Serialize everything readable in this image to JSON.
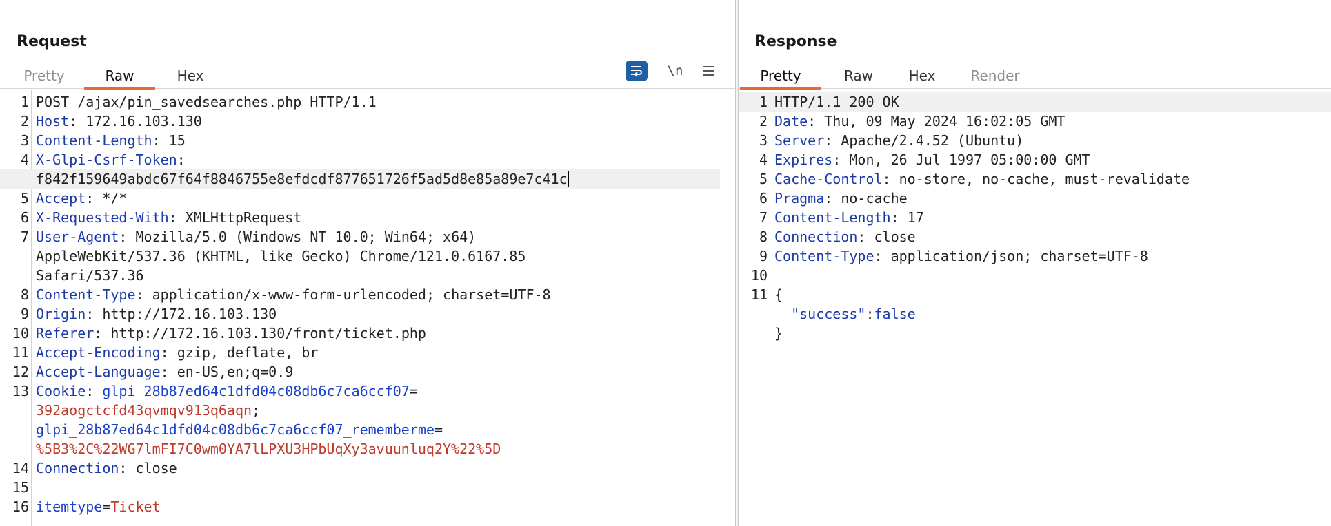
{
  "request": {
    "title": "Request",
    "tabs": [
      {
        "label": "Pretty",
        "state": "disabled"
      },
      {
        "label": "Raw",
        "state": "active"
      },
      {
        "label": "Hex",
        "state": "normal"
      }
    ],
    "toolbar": {
      "wrap_icon": "text-wrap-icon",
      "newline_label": "\\n",
      "menu_icon": "hamburger-menu-icon"
    },
    "lines": [
      {
        "n": "1",
        "plain": "POST /ajax/pin_savedsearches.php HTTP/1.1"
      },
      {
        "n": "2",
        "key": "Host",
        "value": "172.16.103.130"
      },
      {
        "n": "3",
        "key": "Content-Length",
        "value": "15"
      },
      {
        "n": "4",
        "key": "X-Glpi-Csrf-Token",
        "value": ""
      },
      {
        "n": "",
        "plain": "f842f159649abdc67f64f8846755e8efdcdf877651726f5ad5d8e85a89e7c41c",
        "current": true
      },
      {
        "n": "5",
        "key": "Accept",
        "value": "*/*"
      },
      {
        "n": "6",
        "key": "X-Requested-With",
        "value": "XMLHttpRequest"
      },
      {
        "n": "7",
        "key": "User-Agent",
        "value": "Mozilla/5.0 (Windows NT 10.0; Win64; x64)"
      },
      {
        "n": "",
        "plain": "AppleWebKit/537.36 (KHTML, like Gecko) Chrome/121.0.6167.85"
      },
      {
        "n": "",
        "plain": "Safari/537.36"
      },
      {
        "n": "8",
        "key": "Content-Type",
        "value": "application/x-www-form-urlencoded; charset=UTF-8"
      },
      {
        "n": "9",
        "key": "Origin",
        "value": "http://172.16.103.130"
      },
      {
        "n": "10",
        "key": "Referer",
        "value": "http://172.16.103.130/front/ticket.php"
      },
      {
        "n": "11",
        "key": "Accept-Encoding",
        "value": "gzip, deflate, br"
      },
      {
        "n": "12",
        "key": "Accept-Language",
        "value": "en-US,en;q=0.9"
      },
      {
        "n": "13",
        "key": "Cookie",
        "cookie_name": "glpi_28b87ed64c1dfd04c08db6c7ca6ccf07",
        "sep": "="
      },
      {
        "n": "",
        "cookie_value": "392aogctcfd43qvmqv913q6aqn",
        "sep": ";"
      },
      {
        "n": "",
        "cookie_name": "glpi_28b87ed64c1dfd04c08db6c7ca6ccf07_rememberme",
        "sep": "="
      },
      {
        "n": "",
        "cookie_value": "%5B3%2C%22WG7lmFI7C0wm0YA7lLPXU3HPbUqXy3avuunluq2Y%22%5D"
      },
      {
        "n": "14",
        "key": "Connection",
        "value": "close"
      },
      {
        "n": "15",
        "plain": ""
      },
      {
        "n": "16",
        "param_name": "itemtype",
        "sep": "=",
        "param_value": "Ticket"
      }
    ]
  },
  "response": {
    "title": "Response",
    "tabs": [
      {
        "label": "Pretty",
        "state": "active"
      },
      {
        "label": "Raw",
        "state": "normal"
      },
      {
        "label": "Hex",
        "state": "normal"
      },
      {
        "label": "Render",
        "state": "disabled"
      }
    ],
    "lines": [
      {
        "n": "1",
        "plain": "HTTP/1.1 200 OK",
        "current": true
      },
      {
        "n": "2",
        "key": "Date",
        "value": "Thu, 09 May 2024 16:02:05 GMT"
      },
      {
        "n": "3",
        "key": "Server",
        "value": "Apache/2.4.52 (Ubuntu)"
      },
      {
        "n": "4",
        "key": "Expires",
        "value": "Mon, 26 Jul 1997 05:00:00 GMT"
      },
      {
        "n": "5",
        "key": "Cache-Control",
        "value": "no-store, no-cache, must-revalidate"
      },
      {
        "n": "6",
        "key": "Pragma",
        "value": "no-cache"
      },
      {
        "n": "7",
        "key": "Content-Length",
        "value": "17"
      },
      {
        "n": "8",
        "key": "Connection",
        "value": "close"
      },
      {
        "n": "9",
        "key": "Content-Type",
        "value": "application/json; charset=UTF-8"
      },
      {
        "n": "10",
        "plain": ""
      },
      {
        "n": "11",
        "plain": "{"
      },
      {
        "n": "",
        "json_key": "\"success\"",
        "sep": ":",
        "json_value": "false",
        "indent": "  "
      },
      {
        "n": "",
        "plain": "}"
      }
    ]
  },
  "colors": {
    "header_key": "#1c3aa8",
    "cookie_name": "#1a3fcc",
    "cookie_value": "#c0392b",
    "active_tab_underline": "#e8663a",
    "wrap_button_bg": "#1f5fa6"
  }
}
